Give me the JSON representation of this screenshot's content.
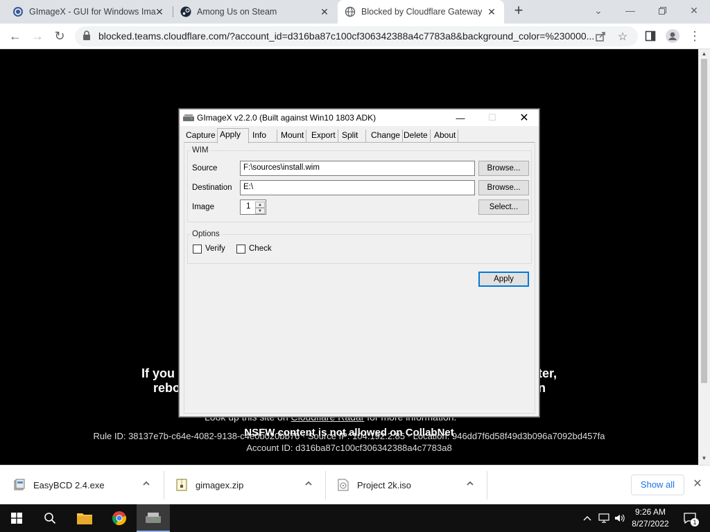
{
  "browser": {
    "tabs": [
      {
        "title": "GImageX - GUI for Windows Ima",
        "icon": "gimagex-icon",
        "active": false
      },
      {
        "title": "Among Us on Steam",
        "icon": "steam-icon",
        "active": false
      },
      {
        "title": "Blocked by Cloudflare Gateway",
        "icon": "globe-icon",
        "active": true
      }
    ],
    "url": "blocked.teams.cloudflare.com/?account_id=d316ba87c100cf306342388a4c7783a8&background_color=%230000..."
  },
  "blocked_page": {
    "line1_left": "If you a",
    "line1_right": "ter,",
    "line2_left": "rebo",
    "line2_right": "n",
    "lookup_prefix": "Look up this site on",
    "lookup_link": "Cloudflare Radar",
    "lookup_suffix": "for more information.",
    "nsfw_message": "NSFW content is not allowed on CollabNet",
    "rule_id_line": "Rule ID: 38137e7b-c64e-4082-9138-c4e0b020bb76 · Source IP: 104.192.2.85 · Location: 946dd7f6d58f49d3b096a7092bd457fa",
    "account_id_line": "Account ID: d316ba87c100cf306342388a4c7783a8"
  },
  "dialog": {
    "title": "GImageX v2.2.0 (Built against Win10 1803 ADK)",
    "tabs": [
      "Capture",
      "Apply",
      "Info",
      "Mount",
      "Export",
      "Split",
      "Change",
      "Delete",
      "About"
    ],
    "selected_tab": "Apply",
    "wim_group": {
      "label": "WIM",
      "source_label": "Source",
      "source_value": "F:\\sources\\install.wim",
      "destination_label": "Destination",
      "destination_value": "E:\\",
      "image_label": "Image",
      "image_value": "1",
      "browse_label": "Browse...",
      "select_label": "Select..."
    },
    "options_group": {
      "label": "Options",
      "verify_label": "Verify",
      "verify_checked": false,
      "check_label": "Check",
      "check_checked": false
    },
    "apply_button": "Apply"
  },
  "downloads": [
    {
      "name": "EasyBCD 2.4.exe",
      "icon": "exe-file-icon"
    },
    {
      "name": "gimagex.zip",
      "icon": "zip-file-icon"
    },
    {
      "name": "Project 2k.iso",
      "icon": "iso-file-icon"
    }
  ],
  "downloads_show_all": "Show all",
  "taskbar": {
    "time": "9:26 AM",
    "date": "8/27/2022",
    "notification_count": "1"
  },
  "colors": {
    "accent": "#0078d7",
    "link": "#1a73e8",
    "page_bg": "#000000"
  }
}
